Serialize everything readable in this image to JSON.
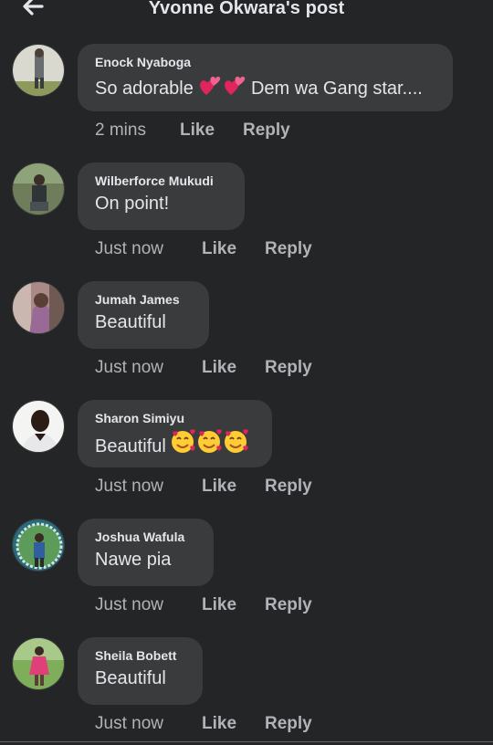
{
  "header": {
    "title": "Yvonne Okwara's post",
    "back_icon": "arrow-left-icon"
  },
  "colors": {
    "background": "#242526",
    "bubble": "#3a3b3c",
    "primary_text": "#e4e6eb",
    "secondary_text": "#b0b3b8"
  },
  "comments": [
    {
      "author": "Enock Nyaboga",
      "text_before_emoji": "So adorable ",
      "emoji": "hearts-emoji",
      "text_after_emoji": " Dem wa Gang star....",
      "time": "2 mins",
      "like": "Like",
      "reply": "Reply"
    },
    {
      "author": "Wilberforce Mukudi",
      "text": "On point!",
      "time": "Just now",
      "like": "Like",
      "reply": "Reply"
    },
    {
      "author": "Jumah James",
      "text": "Beautiful",
      "time": "Just now",
      "like": "Like",
      "reply": "Reply"
    },
    {
      "author": "Sharon Simiyu",
      "text": "Beautiful",
      "emoji": "smiling-face-with-hearts-emoji",
      "time": "Just now",
      "like": "Like",
      "reply": "Reply"
    },
    {
      "author": "Joshua Wafula",
      "text": "Nawe pia",
      "time": "Just now",
      "like": "Like",
      "reply": "Reply"
    },
    {
      "author": "Sheila Bobett",
      "text": "Beautiful",
      "time": "Just now",
      "like": "Like",
      "reply": "Reply"
    }
  ]
}
